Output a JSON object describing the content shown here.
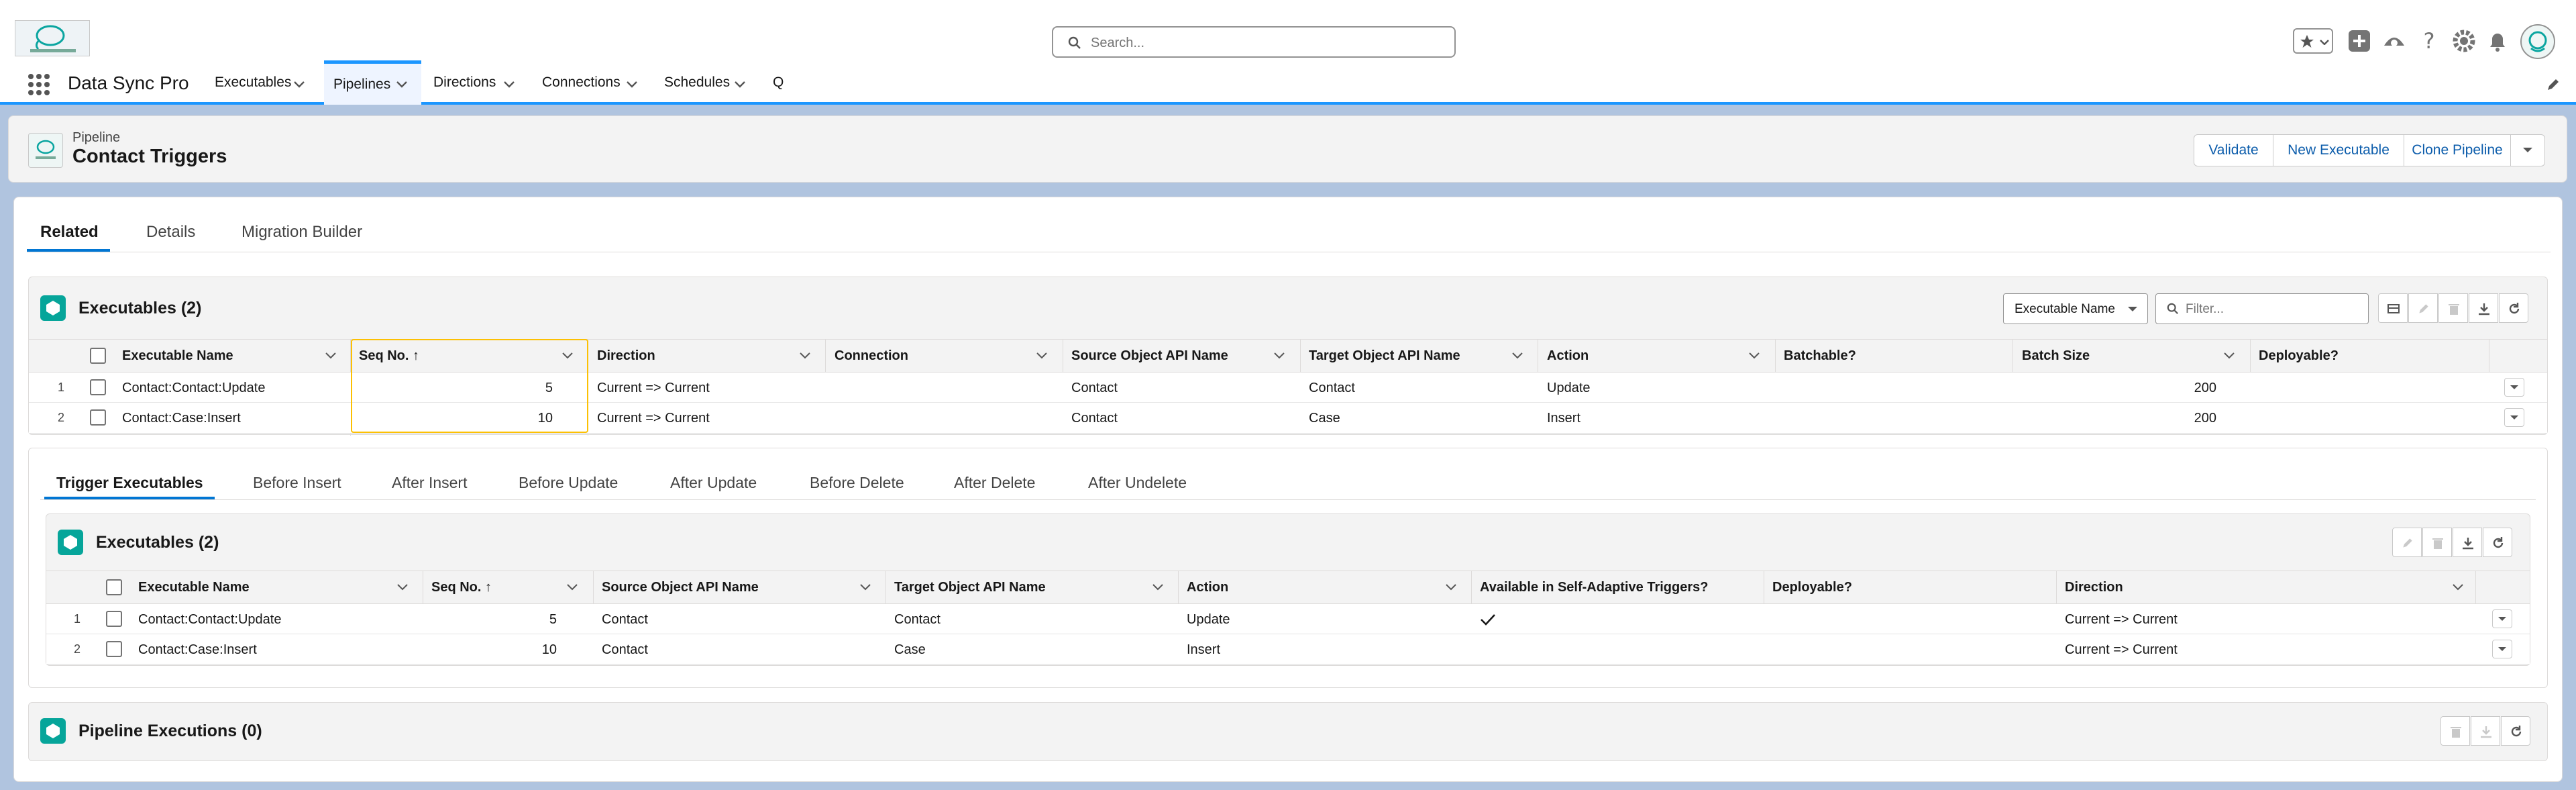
{
  "app": {
    "name": "Data Sync Pro"
  },
  "search": {
    "placeholder": "Search..."
  },
  "nav": {
    "items": [
      "Executables",
      "Pipelines",
      "Directions",
      "Connections",
      "Schedules",
      "Q"
    ]
  },
  "record": {
    "type": "Pipeline",
    "title": "Contact Triggers",
    "actions": [
      "Validate",
      "New Executable",
      "Clone Pipeline"
    ]
  },
  "tabs": [
    "Related",
    "Details",
    "Migration Builder"
  ],
  "exec1": {
    "title": "Executables (2)",
    "sort_select": "Executable Name",
    "filter_placeholder": "Filter...",
    "columns": [
      "Executable Name",
      "Seq No. ↑",
      "Direction",
      "Connection",
      "Source Object API Name",
      "Target Object API Name",
      "Action",
      "Batchable?",
      "Batch Size",
      "Deployable?"
    ],
    "rows": [
      {
        "num": "1",
        "name": "Contact:Contact:Update",
        "seq": "5",
        "direction": "Current => Current",
        "connection": "",
        "source": "Contact",
        "target": "Contact",
        "action": "Update",
        "batchable": "",
        "batch_size": "200",
        "deployable": ""
      },
      {
        "num": "2",
        "name": "Contact:Case:Insert",
        "seq": "10",
        "direction": "Current => Current",
        "connection": "",
        "source": "Contact",
        "target": "Case",
        "action": "Insert",
        "batchable": "",
        "batch_size": "200",
        "deployable": ""
      }
    ]
  },
  "subtabs": [
    "Trigger Executables",
    "Before Insert",
    "After Insert",
    "Before Update",
    "After Update",
    "Before Delete",
    "After Delete",
    "After Undelete"
  ],
  "exec2": {
    "title": "Executables (2)",
    "columns": [
      "Executable Name",
      "Seq No. ↑",
      "Source Object API Name",
      "Target Object API Name",
      "Action",
      "Available in Self-Adaptive Triggers?",
      "Deployable?",
      "Direction"
    ],
    "rows": [
      {
        "num": "1",
        "name": "Contact:Contact:Update",
        "seq": "5",
        "source": "Contact",
        "target": "Contact",
        "action": "Update",
        "adaptive": true,
        "deployable": "",
        "direction": "Current => Current"
      },
      {
        "num": "2",
        "name": "Contact:Case:Insert",
        "seq": "10",
        "source": "Contact",
        "target": "Case",
        "action": "Insert",
        "adaptive": false,
        "deployable": "",
        "direction": "Current => Current"
      }
    ]
  },
  "executions": {
    "title": "Pipeline Executions (0)"
  },
  "colors": {
    "brand": "#0176d3",
    "link": "#0b5cab",
    "icon_teal": "#06a59a",
    "highlight": "#fcc003",
    "nav_accent": "#1b96ff"
  }
}
